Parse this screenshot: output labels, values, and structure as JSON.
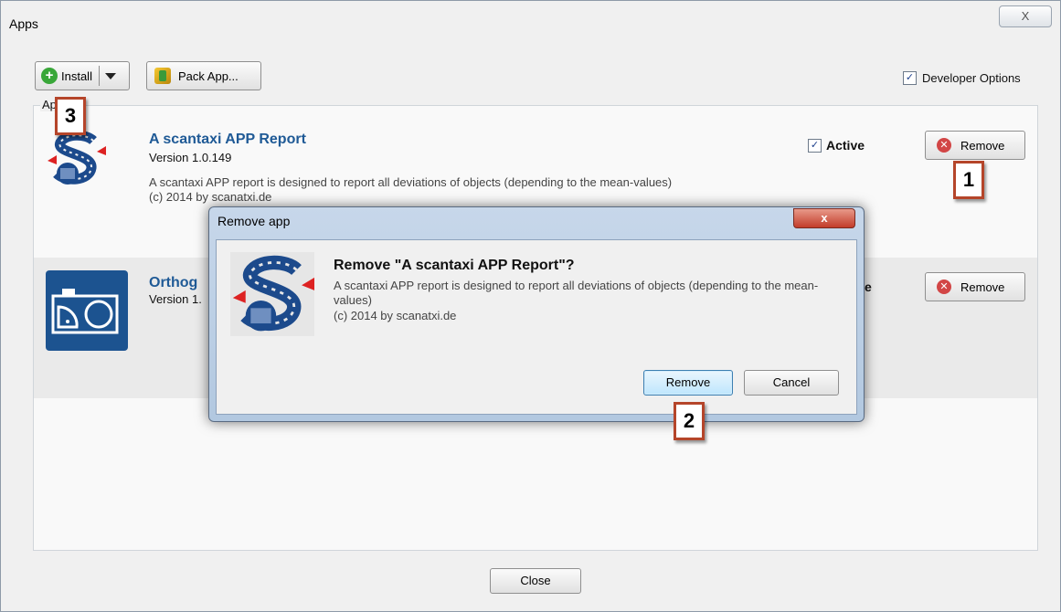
{
  "window": {
    "title": "Apps",
    "close_glyph": "X"
  },
  "toolbar": {
    "install_label": "Install",
    "pack_label": "Pack App...",
    "developer_options_label": "Developer Options",
    "developer_options_checked": true
  },
  "group_label": "Ap",
  "apps": [
    {
      "name": "A scantaxi APP Report",
      "version": "Version 1.0.149",
      "description": "A scantaxi APP report is designed to report all deviations of objects (depending to the mean-values)",
      "copyright": "(c) 2014 by scanatxi.de",
      "active_label": "Active",
      "active": true,
      "remove_label": "Remove"
    },
    {
      "name": "Orthog",
      "version": "Version 1.",
      "active_label": "e",
      "remove_label": "Remove"
    }
  ],
  "dialog": {
    "title": "Remove app",
    "close_glyph": "x",
    "heading": "Remove \"A scantaxi APP Report\"?",
    "description": "A scantaxi APP report is designed to report all deviations of objects (depending to the mean-values)",
    "copyright": "(c) 2014 by scanatxi.de",
    "remove_label": "Remove",
    "cancel_label": "Cancel"
  },
  "callouts": {
    "one": "1",
    "two": "2",
    "three": "3"
  },
  "footer": {
    "close_label": "Close"
  }
}
